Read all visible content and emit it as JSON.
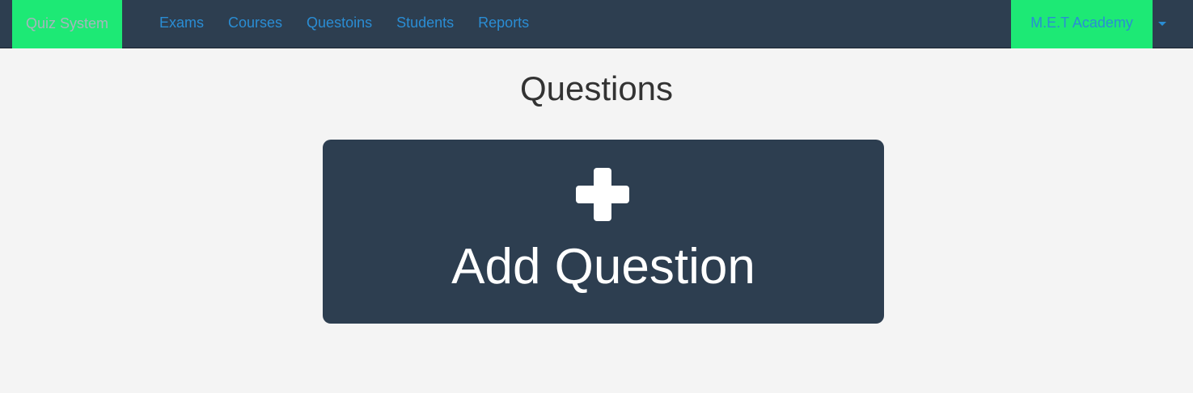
{
  "navbar": {
    "brand": "Quiz System",
    "links": [
      {
        "label": "Exams"
      },
      {
        "label": "Courses"
      },
      {
        "label": "Questoins"
      },
      {
        "label": "Students"
      },
      {
        "label": "Reports"
      }
    ],
    "account": "M.E.T Academy",
    "dropdown_icon": "caret-down-icon"
  },
  "main": {
    "title": "Questions",
    "add_card": {
      "icon": "plus-icon",
      "label": "Add Question"
    }
  },
  "colors": {
    "navbar_bg": "#2d3e50",
    "accent_green": "#1de975",
    "link_blue": "#2a8dd4",
    "page_bg": "#f4f4f4",
    "card_bg": "#2d3e50"
  }
}
